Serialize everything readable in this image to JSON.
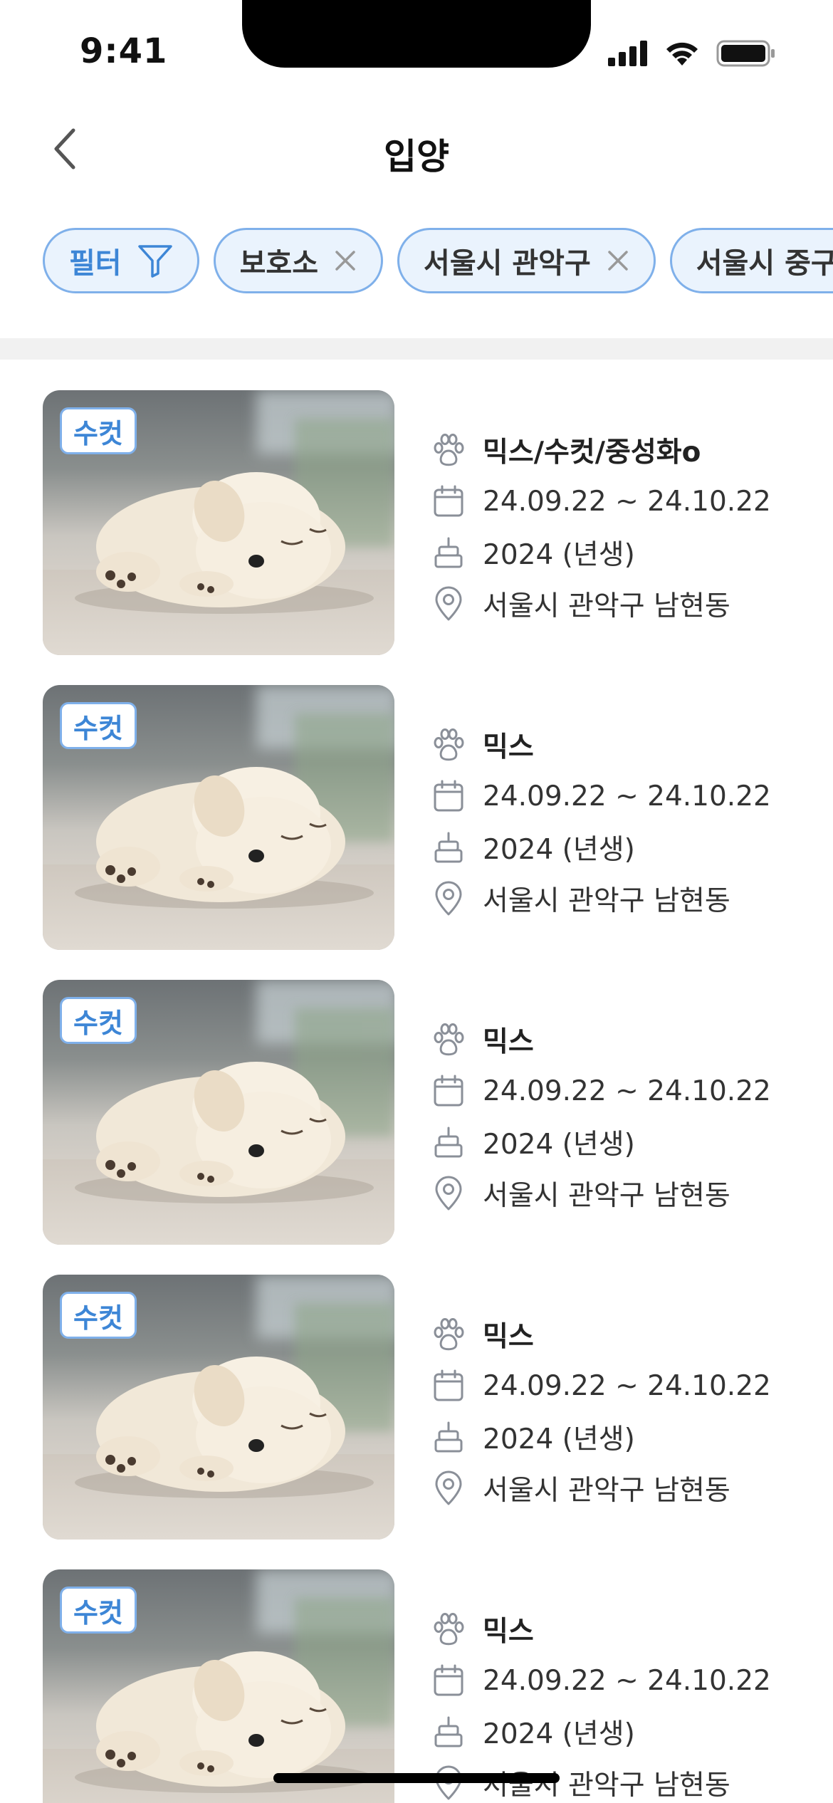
{
  "status_bar": {
    "time": "9:41"
  },
  "header": {
    "title": "입양"
  },
  "filters": {
    "filter_label": "필터",
    "chips": [
      {
        "label": "보호소"
      },
      {
        "label": "서울시 관악구"
      },
      {
        "label": "서울시 중구"
      }
    ]
  },
  "colors": {
    "accent": "#3d86d6",
    "chip_border": "#7fb0ea",
    "chip_bg": "#eaf3fd"
  },
  "animals": [
    {
      "tag": "수컷",
      "breed": "믹스/수컷/중성화o",
      "period": "24.09.22 ~ 24.10.22",
      "birth": "2024 (년생)",
      "location": "서울시 관악구 남현동"
    },
    {
      "tag": "수컷",
      "breed": "믹스",
      "period": "24.09.22 ~ 24.10.22",
      "birth": "2024 (년생)",
      "location": "서울시 관악구 남현동"
    },
    {
      "tag": "수컷",
      "breed": "믹스",
      "period": "24.09.22 ~ 24.10.22",
      "birth": "2024 (년생)",
      "location": "서울시 관악구 남현동"
    },
    {
      "tag": "수컷",
      "breed": "믹스",
      "period": "24.09.22 ~ 24.10.22",
      "birth": "2024 (년생)",
      "location": "서울시 관악구 남현동"
    },
    {
      "tag": "수컷",
      "breed": "믹스",
      "period": "24.09.22 ~ 24.10.22",
      "birth": "2024 (년생)",
      "location": "서울시 관악구 남현동"
    }
  ]
}
